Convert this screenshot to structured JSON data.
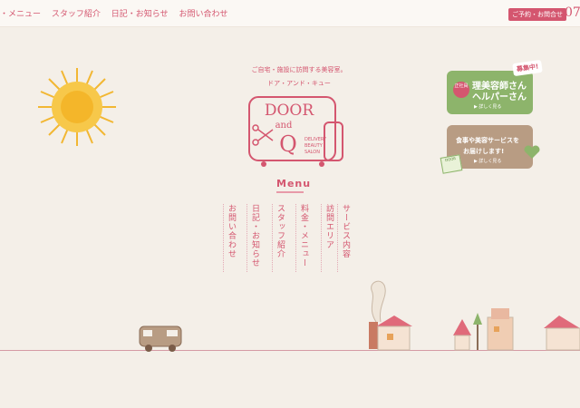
{
  "header": {
    "nav": [
      "・メニュー",
      "スタッフ紹介",
      "日記・お知らせ",
      "お問い合わせ"
    ],
    "reserve_label": "ご予約・お問合せ",
    "phone_partial": "07"
  },
  "hero": {
    "tagline_1": "ご自宅・施設に訪問する美容室。",
    "tagline_2": "ドア・アンド・キュー",
    "logo_line1": "DOOR",
    "logo_line2": "and",
    "logo_line3": "Q",
    "logo_sub1": "DELIVERY",
    "logo_sub2": "BEAUTY",
    "logo_sub3": "SALON",
    "menu_title": "Menu"
  },
  "menu": {
    "items": [
      "サービス内容",
      "訪問エリア",
      "料金・メニュー",
      "スタッフ紹介",
      "日記・お知らせ",
      "お問い合わせ"
    ]
  },
  "banners": {
    "recruit": {
      "badge": "募集中!",
      "circle_text": "正社員",
      "line1": "理美容師さん",
      "line2": "ヘルパーさん",
      "detail": "▶ 詳しく見る"
    },
    "meal": {
      "line1": "食事や美容サービスを",
      "line2": "お届けします!",
      "tag": "DOOR",
      "detail": "▶ 詳しく見る"
    }
  },
  "colors": {
    "accent": "#d4566f",
    "green": "#8db46b",
    "brown": "#b89c83",
    "background": "#f4efe8"
  }
}
